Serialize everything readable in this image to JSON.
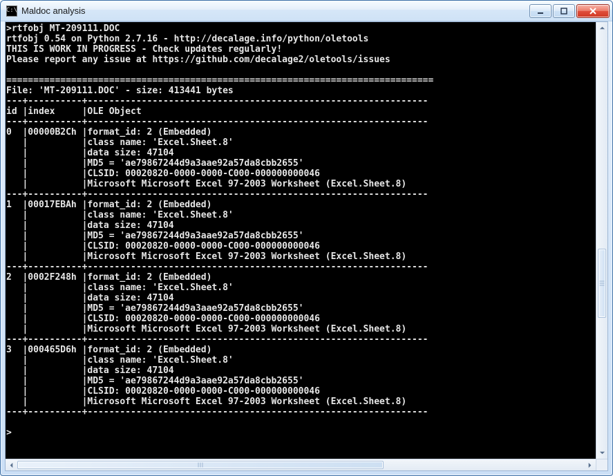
{
  "window": {
    "icon_text": "C:\\",
    "title": "Maldoc analysis"
  },
  "terminal": {
    "prompt": ">",
    "command": "rtfobj MT-209111.DOC",
    "banner": [
      "rtfobj 0.54 on Python 2.7.16 - http://decalage.info/python/oletools",
      "THIS IS WORK IN PROGRESS - Check updates regularly!",
      "Please report any issue at https://github.com/decalage2/oletools/issues"
    ],
    "sep_eq": "===============================================================================",
    "file_line": "File: 'MT-209111.DOC' - size: 413441 bytes",
    "table_sep": "---+----------+---------------------------------------------------------------",
    "table_header": "id |index     |OLE Object                                                     ",
    "rows": [
      {
        "id": "0",
        "index": "00000B2Ch",
        "lines": [
          "format_id: 2 (Embedded)",
          "class name: 'Excel.Sheet.8'",
          "data size: 47104",
          "MD5 = 'ae79867244d9a3aae92a57da8cbb2655'",
          "CLSID: 00020820-0000-0000-C000-000000000046",
          "Microsoft Microsoft Excel 97-2003 Worksheet (Excel.Sheet.8)"
        ]
      },
      {
        "id": "1",
        "index": "00017EBAh",
        "lines": [
          "format_id: 2 (Embedded)",
          "class name: 'Excel.Sheet.8'",
          "data size: 47104",
          "MD5 = 'ae79867244d9a3aae92a57da8cbb2655'",
          "CLSID: 00020820-0000-0000-C000-000000000046",
          "Microsoft Microsoft Excel 97-2003 Worksheet (Excel.Sheet.8)"
        ]
      },
      {
        "id": "2",
        "index": "0002F248h",
        "lines": [
          "format_id: 2 (Embedded)",
          "class name: 'Excel.Sheet.8'",
          "data size: 47104",
          "MD5 = 'ae79867244d9a3aae92a57da8cbb2655'",
          "CLSID: 00020820-0000-0000-C000-000000000046",
          "Microsoft Microsoft Excel 97-2003 Worksheet (Excel.Sheet.8)"
        ]
      },
      {
        "id": "3",
        "index": "000465D6h",
        "lines": [
          "format_id: 2 (Embedded)",
          "class name: 'Excel.Sheet.8'",
          "data size: 47104",
          "MD5 = 'ae79867244d9a3aae92a57da8cbb2655'",
          "CLSID: 00020820-0000-0000-C000-000000000046",
          "Microsoft Microsoft Excel 97-2003 Worksheet (Excel.Sheet.8)"
        ]
      }
    ],
    "row_prefix_first": "   |          |",
    "row_sep": "---+----------+---------------------------------------------------------------",
    "final_prompt": ">"
  }
}
